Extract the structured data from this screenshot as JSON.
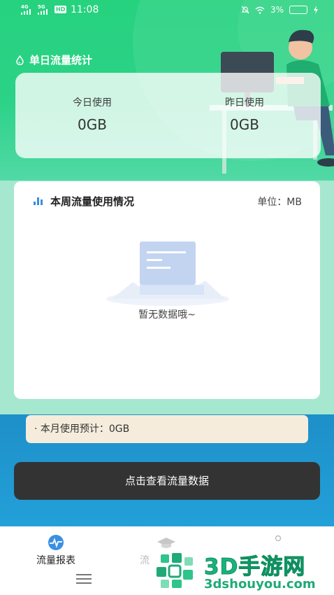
{
  "status_bar": {
    "signal_1": "4G",
    "signal_2": "5G",
    "hd_badge": "HD",
    "time": "11:08",
    "battery": "3%",
    "icons": [
      "mute-icon",
      "wifi-icon",
      "battery-icon",
      "charging-icon"
    ]
  },
  "daily": {
    "title": "单日流量统计",
    "today_label": "今日使用",
    "today_value": "0GB",
    "yesterday_label": "昨日使用",
    "yesterday_value": "0GB"
  },
  "weekly": {
    "title": "本周流量使用情况",
    "unit": "单位：MB",
    "empty_text": "暂无数据哦~"
  },
  "estimate": {
    "text": "· 本月使用预计：0GB"
  },
  "cta": {
    "label": "点击查看流量数据"
  },
  "tabbar": {
    "tabs": [
      {
        "label": "流量报表",
        "icon": "pulse-icon",
        "active": true
      },
      {
        "label": "流",
        "icon": "graduation-cap-icon",
        "active": false
      },
      {
        "label": "",
        "icon": "user-icon",
        "active": false
      }
    ]
  },
  "watermark": {
    "title": "3D手游网",
    "url": "3dshouyou.com"
  },
  "colors": {
    "green": "#2bd287",
    "mint": "#a6e8cf",
    "blue": "#1e8fc9",
    "button": "#333333",
    "estimate_bg": "#f5ecdc"
  }
}
